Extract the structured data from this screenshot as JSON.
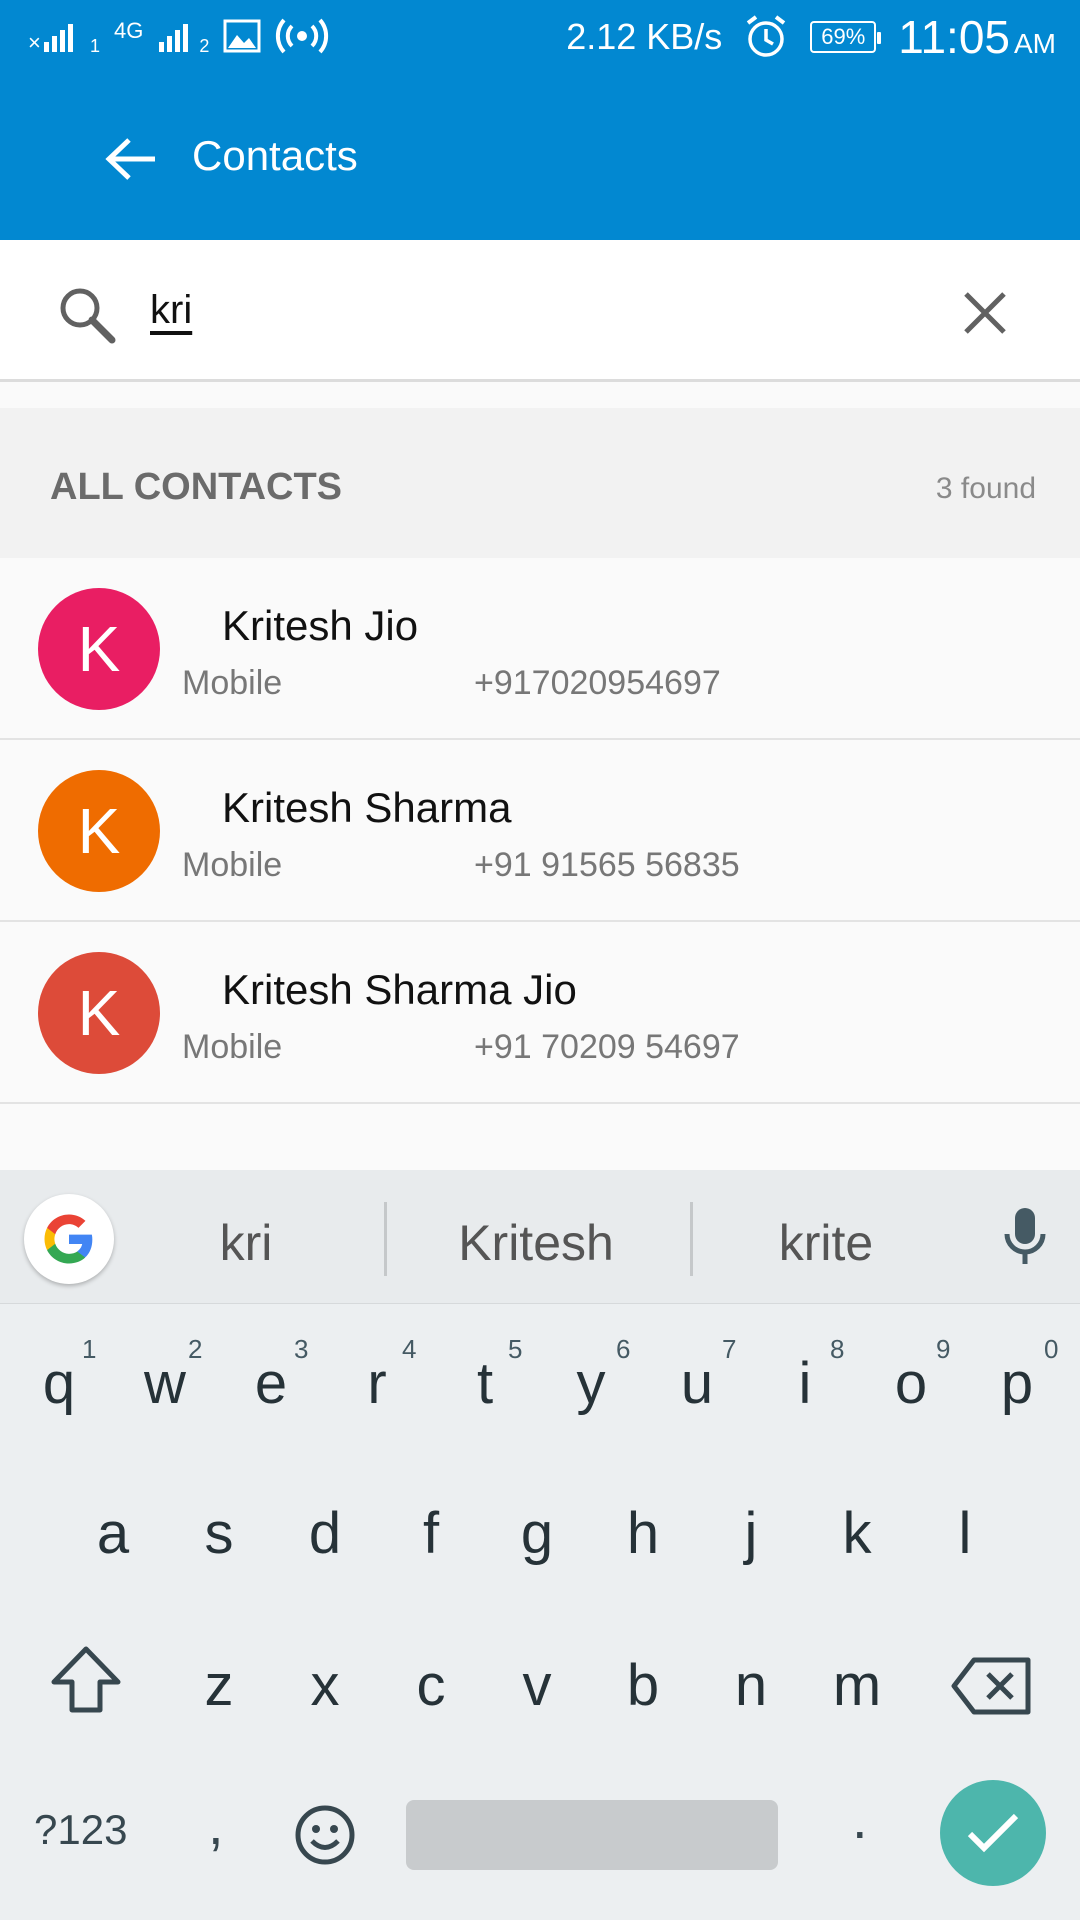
{
  "status_bar": {
    "net_type": "4G",
    "sim1_label": "1",
    "sim2_label": "2",
    "speed": "2.12 KB/s",
    "battery": "69%",
    "time": "11:05",
    "ampm": "AM",
    "icons": [
      "signal-icon",
      "data-arrows-icon",
      "image-icon",
      "hotspot-icon",
      "alarm-icon",
      "battery-icon"
    ]
  },
  "app_bar": {
    "title": "Contacts",
    "color": "#0288d1"
  },
  "search": {
    "value": "kri"
  },
  "section": {
    "title": "ALL CONTACTS",
    "count": "3 found"
  },
  "contacts": [
    {
      "initial": "K",
      "name": "Kritesh Jio",
      "type": "Mobile",
      "phone": "+917020954697",
      "color": "#e91e63"
    },
    {
      "initial": "K",
      "name": "Kritesh Sharma",
      "type": "Mobile",
      "phone": "+91 91565 56835",
      "color": "#ef6c00"
    },
    {
      "initial": "K",
      "name": "Kritesh Sharma Jio",
      "type": "Mobile",
      "phone": "+91 70209 54697",
      "color": "#dd4b39"
    }
  ],
  "keyboard": {
    "suggestions": [
      "kri",
      "Kritesh",
      "krite"
    ],
    "row1": [
      "q",
      "w",
      "e",
      "r",
      "t",
      "y",
      "u",
      "i",
      "o",
      "p"
    ],
    "row1_hints": [
      "1",
      "2",
      "3",
      "4",
      "5",
      "6",
      "7",
      "8",
      "9",
      "0"
    ],
    "row2": [
      "a",
      "s",
      "d",
      "f",
      "g",
      "h",
      "j",
      "k",
      "l"
    ],
    "row3": [
      "z",
      "x",
      "c",
      "v",
      "b",
      "n",
      "m"
    ],
    "symbols_label": "?123",
    "comma": ",",
    "period": ".",
    "enter_color": "#4db6ac"
  }
}
